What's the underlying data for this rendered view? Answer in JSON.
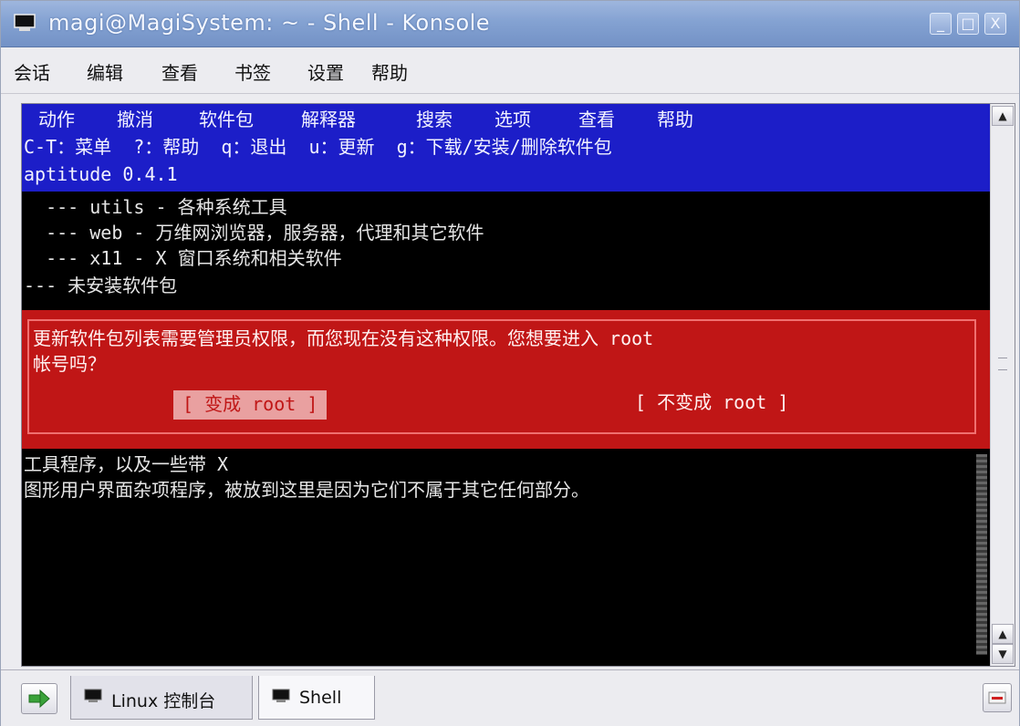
{
  "window": {
    "title": "magi@MagiSystem: ~ - Shell - Konsole",
    "buttons": {
      "minimize": "_",
      "maximize": "□",
      "close": "X"
    }
  },
  "menu": [
    "会话",
    "编辑",
    "查看",
    "书签",
    "设置",
    "帮助"
  ],
  "terminal": {
    "app_menu": [
      "动作",
      "撤消",
      "软件包",
      "解释器",
      "搜索",
      "选项",
      "查看",
      "帮助"
    ],
    "shortcut_line": "C-T：菜单  ?：帮助  q：退出  u：更新  g：下载/安装/删除软件包",
    "version_line": "aptitude 0.4.1",
    "list_lines": [
      "  --- utils - 各种系统工具",
      "  --- web - 万维网浏览器，服务器，代理和其它软件",
      "  --- x11 - X 窗口系统和相关软件",
      "--- 未安装软件包"
    ],
    "dialog": {
      "line1": "更新软件包列表需要管理员权限，而您现在没有这种权限。您想要进入 root",
      "line2": "帐号吗？",
      "yes_button": "[ 变成 root ]",
      "no_button": "[ 不变成 root ]"
    },
    "desc_lines": [
      "工具程序，以及一些带 X",
      "图形用户界面杂项程序，被放到这里是因为它们不属于其它任何部分。"
    ]
  },
  "tabs": [
    {
      "label": "Linux 控制台",
      "active": false
    },
    {
      "label": "Shell",
      "active": true
    }
  ],
  "colors": {
    "menu_bg": "#1c1ec8",
    "dialog_bg": "#c01616",
    "terminal_bg": "#000000",
    "titlebar": "#84a2d2"
  }
}
